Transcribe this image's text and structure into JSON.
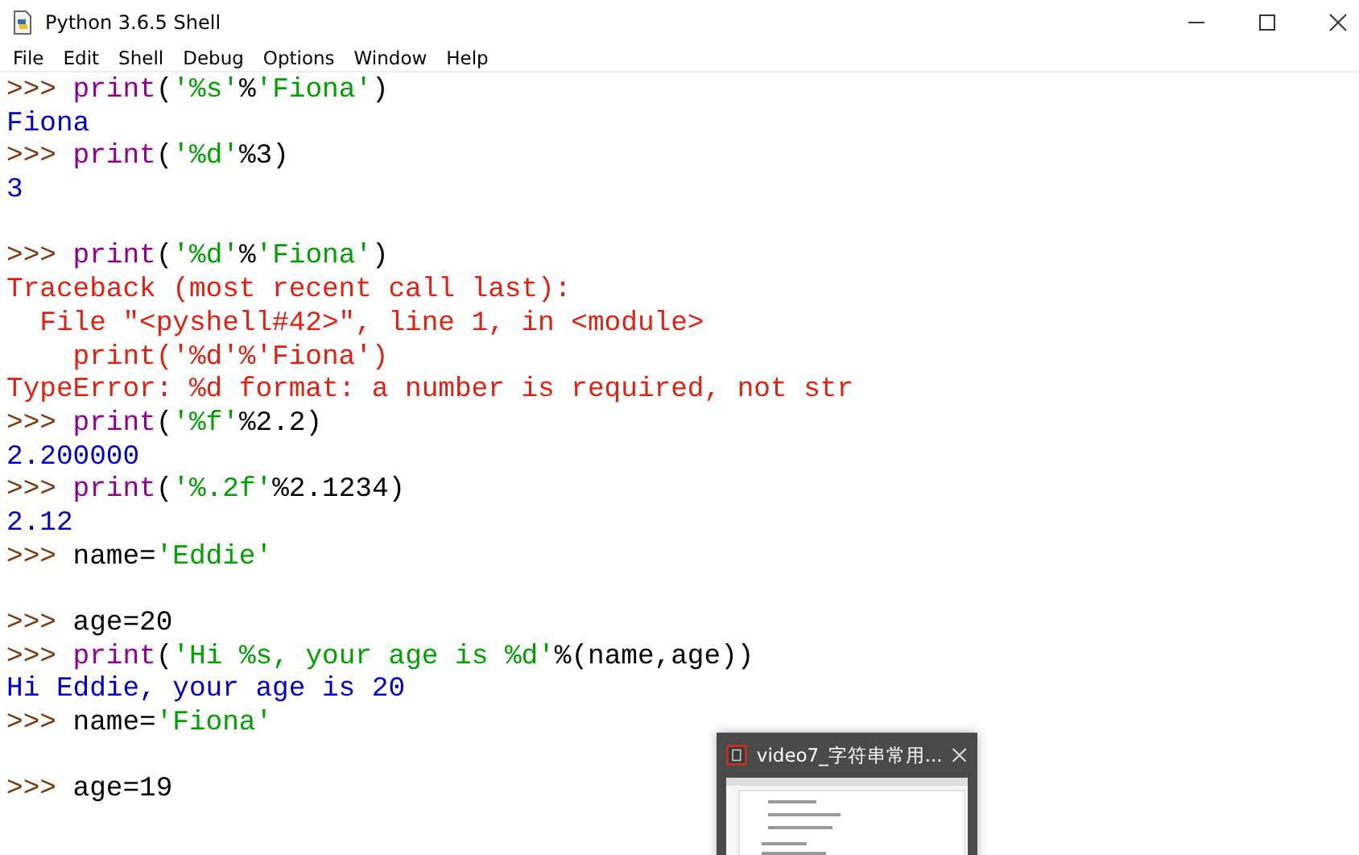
{
  "window": {
    "title": "Python 3.6.5 Shell"
  },
  "menu": [
    "File",
    "Edit",
    "Shell",
    "Debug",
    "Options",
    "Window",
    "Help"
  ],
  "shell_lines": [
    {
      "kind": "input",
      "prompt": ">>>",
      "tokens": [
        {
          "kind": "builtin",
          "text": "print"
        },
        {
          "kind": "plain",
          "text": "("
        },
        {
          "kind": "string",
          "text": "'%s'"
        },
        {
          "kind": "plain",
          "text": "%"
        },
        {
          "kind": "string",
          "text": "'Fiona'"
        },
        {
          "kind": "plain",
          "text": ")"
        }
      ]
    },
    {
      "kind": "output",
      "text": "Fiona"
    },
    {
      "kind": "input",
      "prompt": ">>>",
      "tokens": [
        {
          "kind": "builtin",
          "text": "print"
        },
        {
          "kind": "plain",
          "text": "("
        },
        {
          "kind": "string",
          "text": "'%d'"
        },
        {
          "kind": "plain",
          "text": "%3)"
        }
      ]
    },
    {
      "kind": "output",
      "text": "3"
    },
    {
      "kind": "blank"
    },
    {
      "kind": "input",
      "prompt": ">>>",
      "tokens": [
        {
          "kind": "builtin",
          "text": "print"
        },
        {
          "kind": "plain",
          "text": "("
        },
        {
          "kind": "string",
          "text": "'%d'"
        },
        {
          "kind": "plain",
          "text": "%"
        },
        {
          "kind": "string",
          "text": "'Fiona'"
        },
        {
          "kind": "plain",
          "text": ")"
        }
      ]
    },
    {
      "kind": "error",
      "text": "Traceback (most recent call last):"
    },
    {
      "kind": "error",
      "text": "  File \"<pyshell#42>\", line 1, in <module>"
    },
    {
      "kind": "error",
      "text": "    print('%d'%'Fiona')"
    },
    {
      "kind": "error",
      "text": "TypeError: %d format: a number is required, not str"
    },
    {
      "kind": "input",
      "prompt": ">>>",
      "tokens": [
        {
          "kind": "builtin",
          "text": "print"
        },
        {
          "kind": "plain",
          "text": "("
        },
        {
          "kind": "string",
          "text": "'%f'"
        },
        {
          "kind": "plain",
          "text": "%2.2)"
        }
      ]
    },
    {
      "kind": "output",
      "text": "2.200000"
    },
    {
      "kind": "input",
      "prompt": ">>>",
      "tokens": [
        {
          "kind": "builtin",
          "text": "print"
        },
        {
          "kind": "plain",
          "text": "("
        },
        {
          "kind": "string",
          "text": "'%.2f'"
        },
        {
          "kind": "plain",
          "text": "%2.1234)"
        }
      ]
    },
    {
      "kind": "output",
      "text": "2.12"
    },
    {
      "kind": "input",
      "prompt": ">>>",
      "tokens": [
        {
          "kind": "plain",
          "text": "name="
        },
        {
          "kind": "string",
          "text": "'Eddie'"
        }
      ]
    },
    {
      "kind": "blank"
    },
    {
      "kind": "input",
      "prompt": ">>>",
      "tokens": [
        {
          "kind": "plain",
          "text": "age=20"
        }
      ]
    },
    {
      "kind": "input",
      "prompt": ">>>",
      "tokens": [
        {
          "kind": "builtin",
          "text": "print"
        },
        {
          "kind": "plain",
          "text": "("
        },
        {
          "kind": "string",
          "text": "'Hi %s, your age is %d'"
        },
        {
          "kind": "plain",
          "text": "%(name,age))"
        }
      ]
    },
    {
      "kind": "output",
      "text": "Hi Eddie, your age is 20"
    },
    {
      "kind": "input",
      "prompt": ">>>",
      "tokens": [
        {
          "kind": "plain",
          "text": "name="
        },
        {
          "kind": "string",
          "text": "'Fiona'"
        }
      ]
    },
    {
      "kind": "blank"
    },
    {
      "kind": "input",
      "prompt": ">>>",
      "tokens": [
        {
          "kind": "plain",
          "text": "age=19"
        }
      ]
    }
  ],
  "preview": {
    "title": "video7_字符串常用..."
  }
}
